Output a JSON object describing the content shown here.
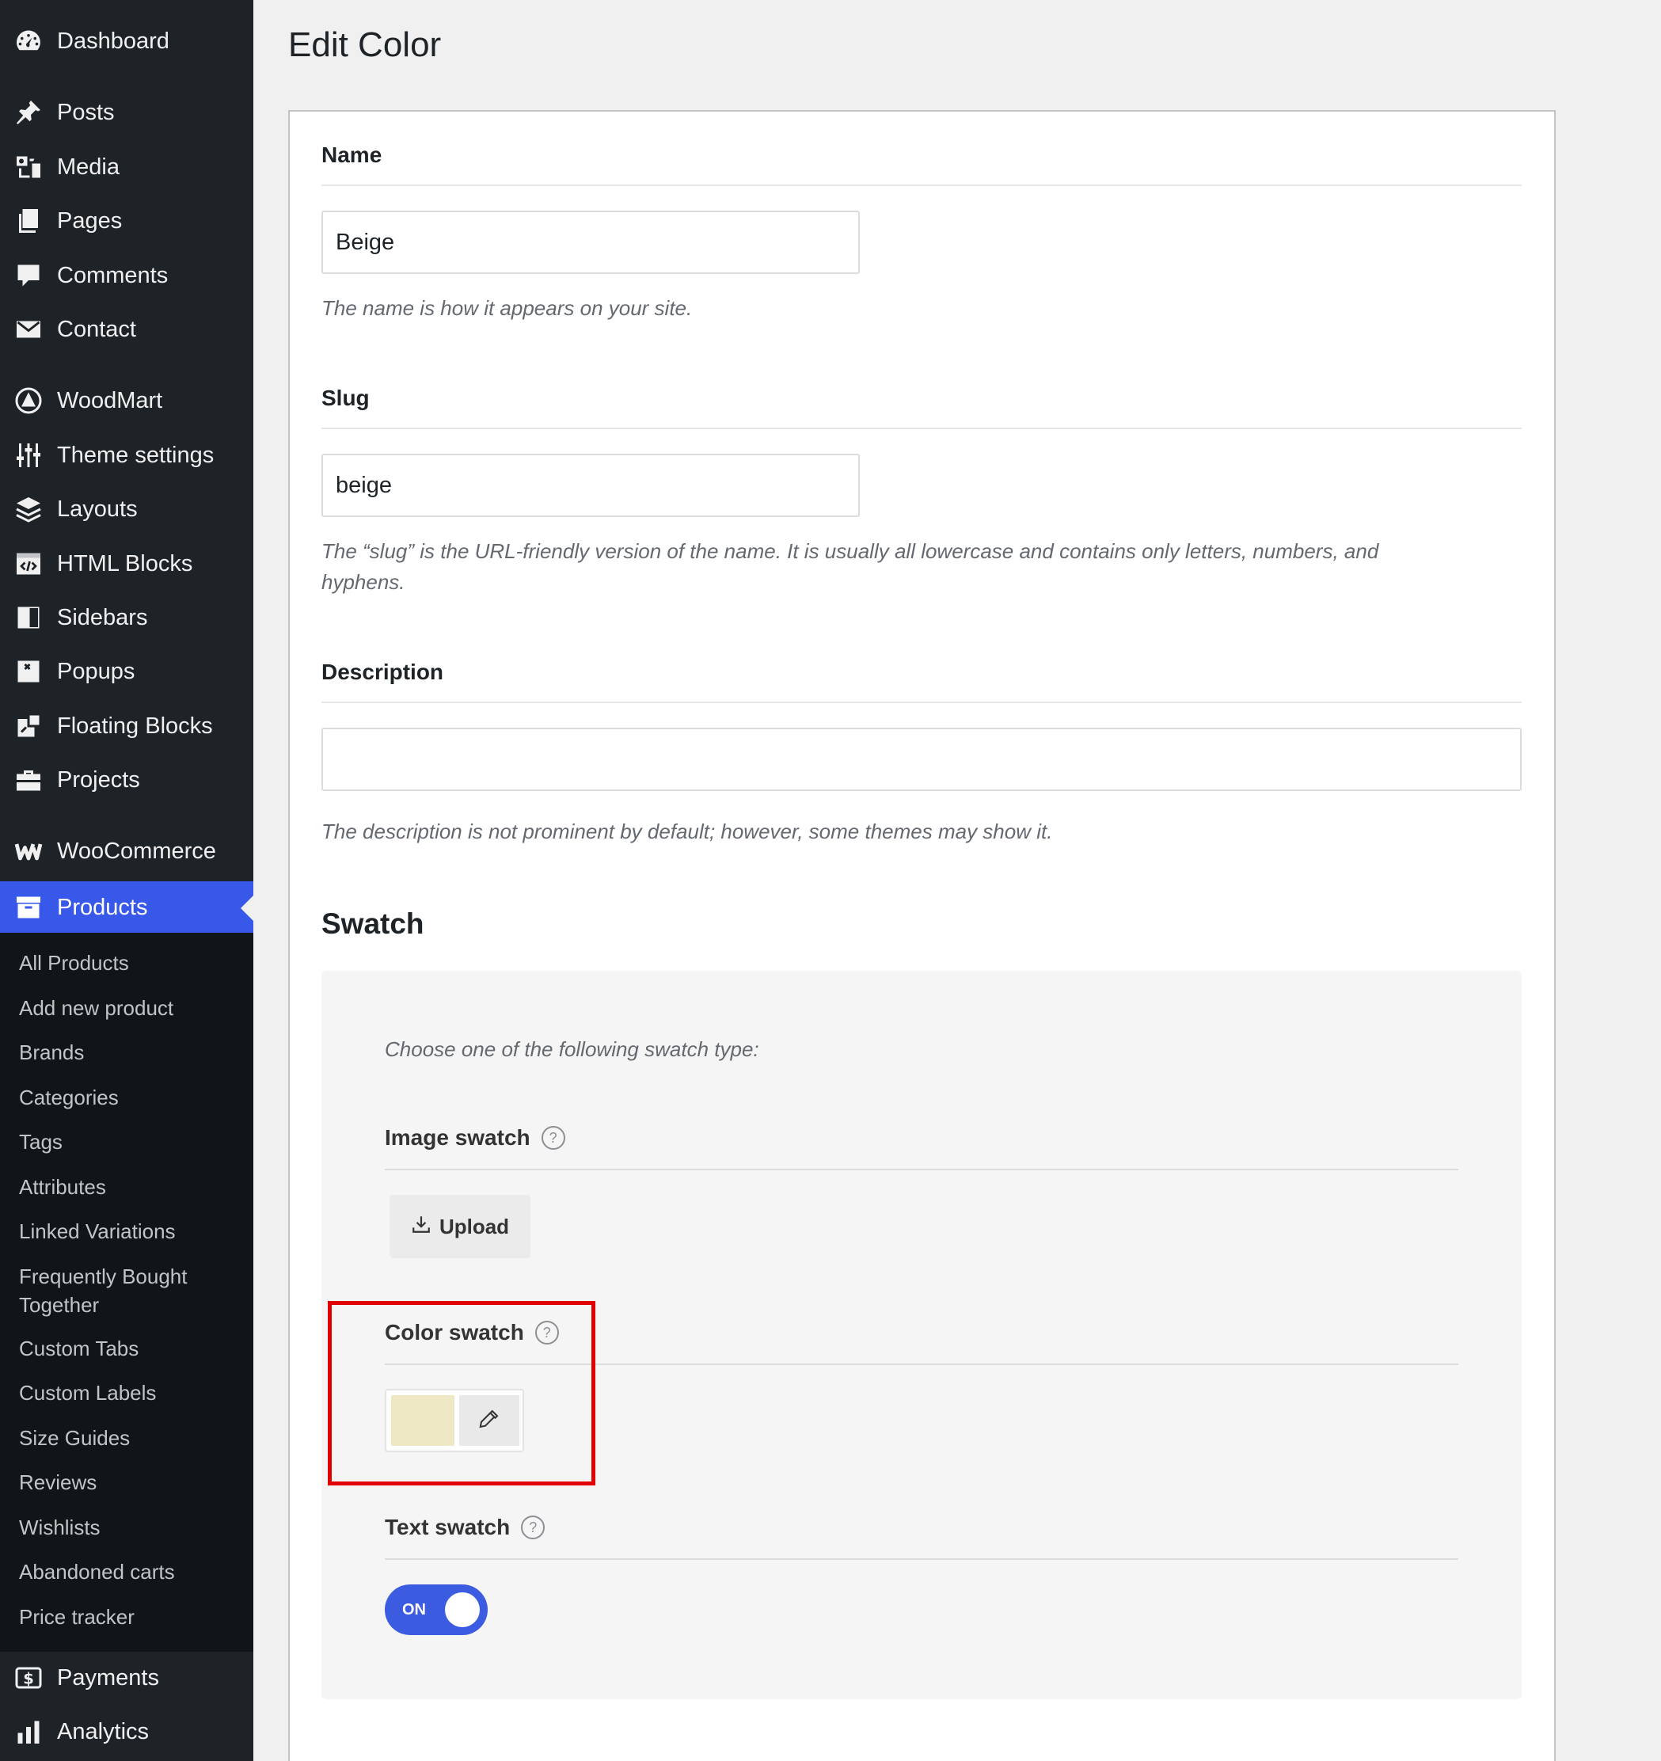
{
  "sidebar": {
    "items": [
      {
        "label": "Dashboard",
        "icon": "dashboard-icon"
      },
      {
        "label": "Posts",
        "icon": "pin-icon"
      },
      {
        "label": "Media",
        "icon": "media-icon"
      },
      {
        "label": "Pages",
        "icon": "pages-icon"
      },
      {
        "label": "Comments",
        "icon": "comment-icon"
      },
      {
        "label": "Contact",
        "icon": "envelope-icon"
      },
      {
        "label": "WoodMart",
        "icon": "woodmart-icon"
      },
      {
        "label": "Theme settings",
        "icon": "sliders-icon"
      },
      {
        "label": "Layouts",
        "icon": "layers-icon"
      },
      {
        "label": "HTML Blocks",
        "icon": "code-icon"
      },
      {
        "label": "Sidebars",
        "icon": "sidebar-icon"
      },
      {
        "label": "Popups",
        "icon": "popup-icon"
      },
      {
        "label": "Floating Blocks",
        "icon": "floating-icon"
      },
      {
        "label": "Projects",
        "icon": "briefcase-icon"
      },
      {
        "label": "WooCommerce",
        "icon": "woo-icon"
      },
      {
        "label": "Products",
        "icon": "archive-icon",
        "current": true
      },
      {
        "label": "Payments",
        "icon": "dollar-icon"
      },
      {
        "label": "Analytics",
        "icon": "bar-chart-icon"
      }
    ],
    "submenu": [
      "All Products",
      "Add new product",
      "Brands",
      "Categories",
      "Tags",
      "Attributes",
      "Linked Variations",
      "Frequently Bought Together",
      "Custom Tabs",
      "Custom Labels",
      "Size Guides",
      "Reviews",
      "Wishlists",
      "Abandoned carts",
      "Price tracker"
    ]
  },
  "main": {
    "title": "Edit Color",
    "name": {
      "label": "Name",
      "value": "Beige",
      "help": "The name is how it appears on your site."
    },
    "slug": {
      "label": "Slug",
      "value": "beige",
      "help_line1": "The “slug” is the URL-friendly version of the name. It is usually all lowercase and contains only letters, numbers, and",
      "help_line2": "hyphens."
    },
    "description": {
      "label": "Description",
      "value": "",
      "help": "The description is not prominent by default; however, some themes may show it."
    },
    "swatch": {
      "heading": "Swatch",
      "intro": "Choose one of the following swatch type:",
      "image_label": "Image swatch",
      "upload_label": "Upload",
      "color_label": "Color swatch",
      "color_value": "#efe8c5",
      "text_label": "Text swatch",
      "toggle_label": "ON",
      "toggle_on": true,
      "help_glyph": "?"
    }
  },
  "colors": {
    "sidebar_bg": "#1d2327",
    "submenu_bg": "#101517",
    "accent": "#3858e9",
    "highlight": "#e00000"
  }
}
